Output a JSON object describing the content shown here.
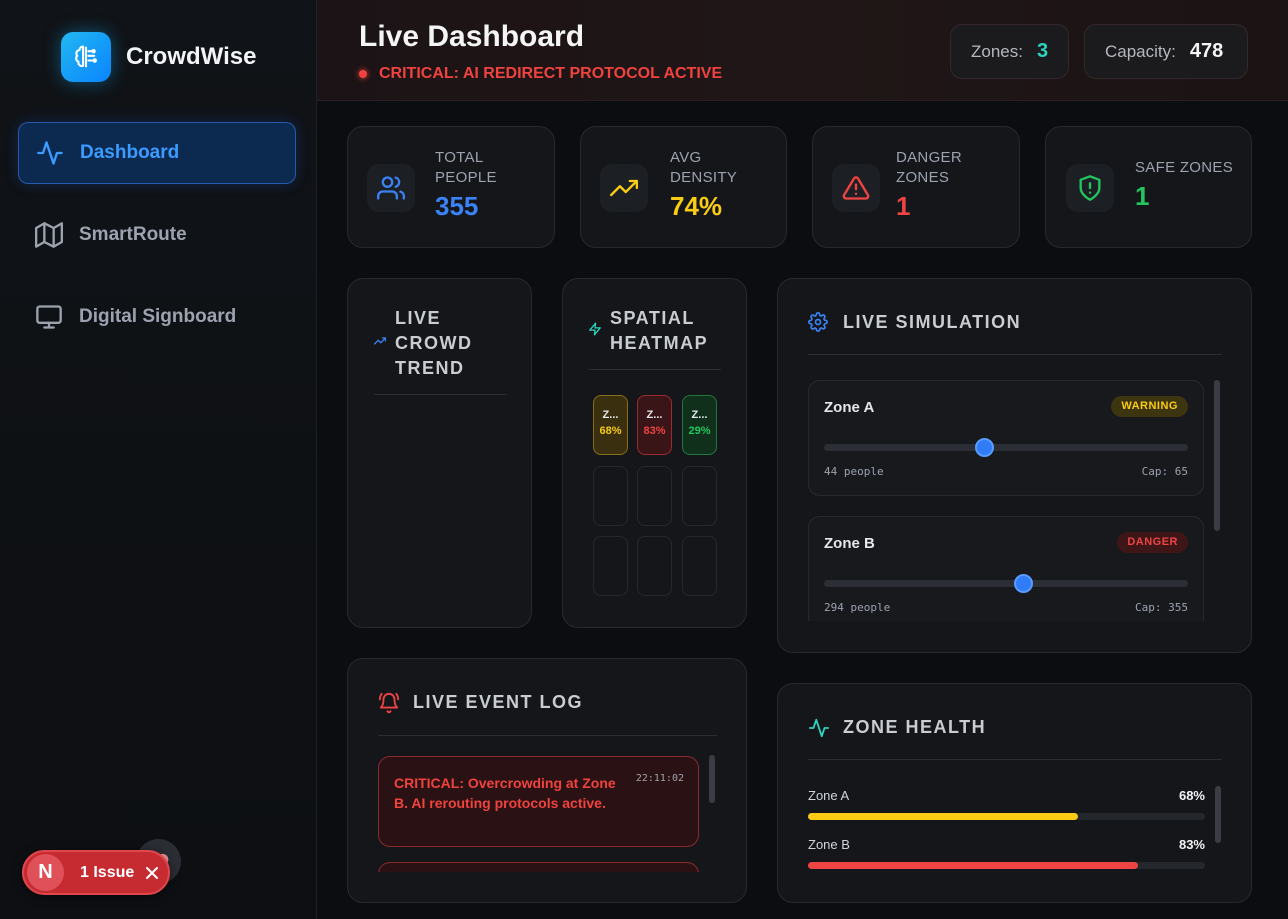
{
  "app": {
    "name": "CrowdWise"
  },
  "sidebar": {
    "items": [
      {
        "label": "Dashboard",
        "icon": "activity-icon",
        "active": true
      },
      {
        "label": "SmartRoute",
        "icon": "map-icon",
        "active": false
      },
      {
        "label": "Digital Signboard",
        "icon": "monitor-icon",
        "active": false
      }
    ]
  },
  "header": {
    "title": "Live Dashboard",
    "alert": "CRITICAL: AI REDIRECT PROTOCOL ACTIVE",
    "zones_label": "Zones:",
    "zones_value": "3",
    "capacity_label": "Capacity:",
    "capacity_value": "478"
  },
  "stats": [
    {
      "label_1": "TOTAL",
      "label_2": "PEOPLE",
      "value": "355",
      "color": "#3b82f6",
      "icon": "users-icon"
    },
    {
      "label_1": "AVG",
      "label_2": "DENSITY",
      "value": "74%",
      "color": "#facc15",
      "icon": "trending-up-icon"
    },
    {
      "label_1": "DANGER",
      "label_2": "ZONES",
      "value": "1",
      "color": "#ef4444",
      "icon": "alert-triangle-icon"
    },
    {
      "label_1": "SAFE ZONES",
      "label_2": "",
      "value": "1",
      "color": "#22c55e",
      "icon": "shield-alert-icon"
    }
  ],
  "trend": {
    "title_1": "LIVE",
    "title_2": "CROWD",
    "title_3": "TREND"
  },
  "heatmap": {
    "title_1": "SPATIAL",
    "title_2": "HEATMAP",
    "cells": [
      {
        "name": "Z...",
        "pct": "68%",
        "level": "warning"
      },
      {
        "name": "Z...",
        "pct": "83%",
        "level": "danger"
      },
      {
        "name": "Z...",
        "pct": "29%",
        "level": "safe"
      }
    ]
  },
  "simulation": {
    "title": "LIVE SIMULATION",
    "zones": [
      {
        "name": "Zone A",
        "status": "WARNING",
        "people": "44 people",
        "cap": "Cap: 65",
        "level": 0.44
      },
      {
        "name": "Zone B",
        "status": "DANGER",
        "people": "294 people",
        "cap": "Cap: 355",
        "level": 0.548
      }
    ]
  },
  "event_log": {
    "title": "LIVE EVENT LOG",
    "events": [
      {
        "message": "CRITICAL: Overcrowding at Zone B. AI rerouting protocols active.",
        "time": "22:11:02"
      }
    ]
  },
  "zone_health": {
    "title": "ZONE HEALTH",
    "rows": [
      {
        "name": "Zone A",
        "pct": "68%",
        "value": 0.68,
        "color": "#facc15"
      },
      {
        "name": "Zone B",
        "pct": "83%",
        "value": 0.83,
        "color": "#ef4444"
      }
    ]
  },
  "issue_badge": {
    "letter": "N",
    "label": "1 Issue"
  },
  "colors": {
    "accent": "#3b82f6",
    "danger": "#ef4444",
    "warning": "#facc15",
    "safe": "#22c55e",
    "teal": "#2dd4bf"
  }
}
